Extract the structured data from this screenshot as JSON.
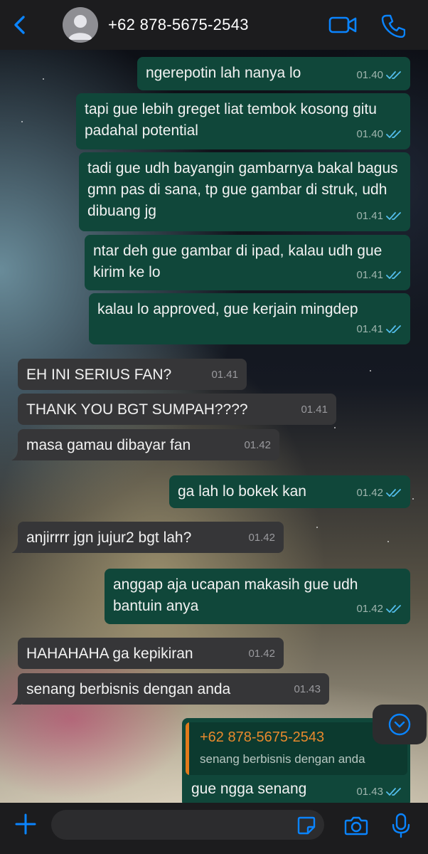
{
  "header": {
    "contact_name": "+62 878-5675-2543",
    "icons": [
      "back-chevron-icon",
      "default-avatar-icon",
      "video-camera-icon",
      "phone-icon"
    ]
  },
  "messages": [
    {
      "dir": "out",
      "text": "ngerepotin lah nanya lo",
      "time": "01.40",
      "read": true
    },
    {
      "dir": "out",
      "text": "tapi gue lebih greget liat tembok kosong gitu padahal potential",
      "time": "01.40",
      "read": true
    },
    {
      "dir": "out",
      "text": "tadi gue udh bayangin gambarnya bakal bagus gmn pas di sana, tp gue gambar di struk, udh dibuang jg",
      "time": "01.41",
      "read": true
    },
    {
      "dir": "out",
      "text": "ntar deh gue gambar di ipad, kalau udh gue kirim ke lo",
      "time": "01.41",
      "read": true
    },
    {
      "dir": "out",
      "text": "kalau lo approved, gue kerjain mingdep",
      "time": "01.41",
      "read": true
    },
    {
      "dir": "in",
      "text": "EH INI SERIUS FAN?",
      "time": "01.41"
    },
    {
      "dir": "in",
      "text": "THANK YOU BGT SUMPAH????",
      "time": "01.41"
    },
    {
      "dir": "in",
      "text": "masa gamau dibayar fan",
      "time": "01.42"
    },
    {
      "dir": "out",
      "text": "ga lah lo bokek kan",
      "time": "01.42",
      "read": true
    },
    {
      "dir": "in",
      "text": "anjirrrr jgn jujur2 bgt lah?",
      "time": "01.42"
    },
    {
      "dir": "out",
      "text": "anggap aja ucapan makasih gue udh bantuin anya",
      "time": "01.42",
      "read": true
    },
    {
      "dir": "in",
      "text": "HAHAHAHA ga kepikiran",
      "time": "01.42"
    },
    {
      "dir": "in",
      "text": "senang berbisnis dengan anda",
      "time": "01.43"
    },
    {
      "dir": "out",
      "text": "gue ngga senang",
      "time": "01.43",
      "read": true,
      "reply_to": {
        "name": "+62 878-5675-2543",
        "text": "senang berbisnis dengan anda"
      }
    }
  ],
  "colors": {
    "outgoing_bubble": "#10473a",
    "incoming_bubble": "#363638",
    "read_ticks": "#53bdeb",
    "accent": "#0a84ff",
    "quote_name": "#e8892d"
  },
  "composer": {
    "placeholder": "",
    "icons": [
      "plus-icon",
      "sticker-icon",
      "camera-icon",
      "microphone-icon"
    ]
  },
  "scroll_button_icon": "chevron-down-icon"
}
